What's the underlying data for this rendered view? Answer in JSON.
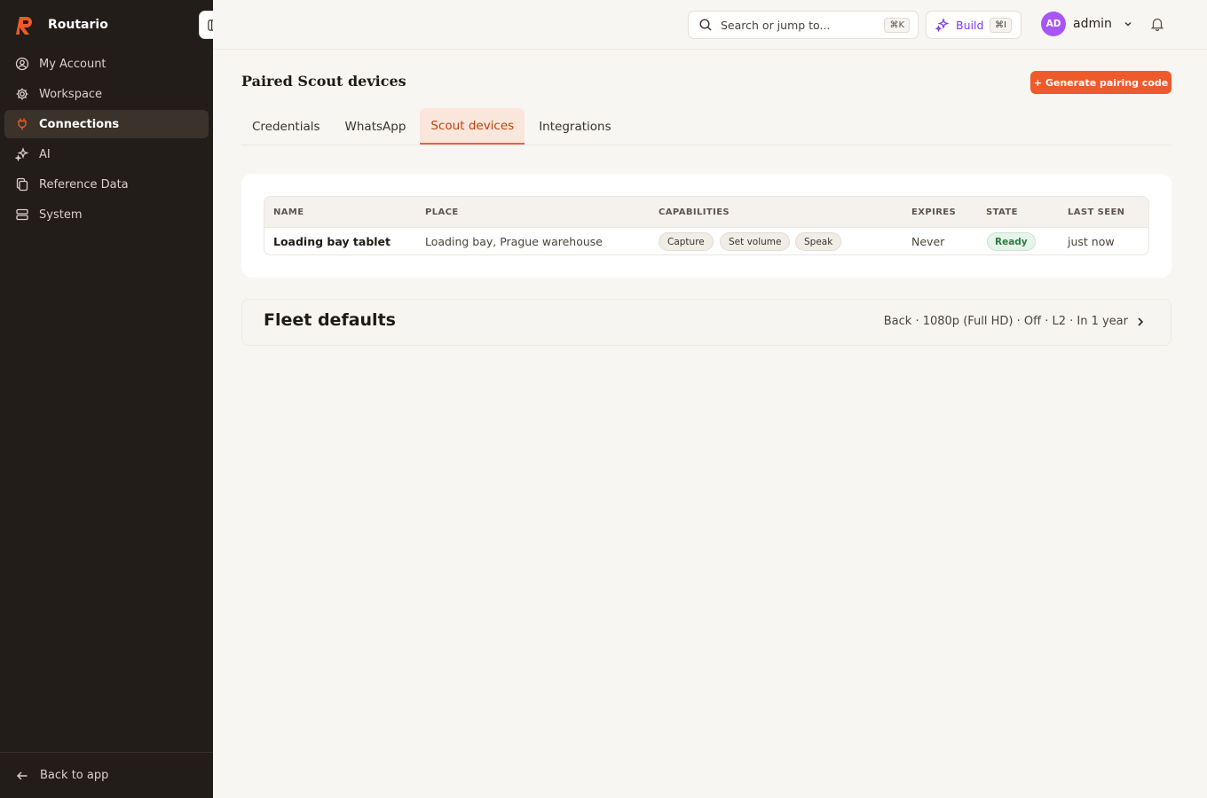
{
  "brand": {
    "name": "Routario",
    "accent": "#ee5a2a"
  },
  "sidebar": {
    "items": [
      {
        "label": "My Account",
        "icon": "user-circle-icon"
      },
      {
        "label": "Workspace",
        "icon": "gear-icon"
      },
      {
        "label": "Connections",
        "icon": "plug-icon",
        "active": true
      },
      {
        "label": "AI",
        "icon": "sparkles-icon"
      },
      {
        "label": "Reference Data",
        "icon": "copy-icon"
      },
      {
        "label": "System",
        "icon": "server-icon"
      }
    ],
    "back_label": "Back to app"
  },
  "topbar": {
    "search_placeholder": "Search or jump to...",
    "search_shortcut": "⌘K",
    "build_label": "Build",
    "build_shortcut": "⌘I",
    "user_initials": "AD",
    "user_name": "admin"
  },
  "page": {
    "title": "Paired Scout devices",
    "generate_button": "+ Generate pairing code",
    "tabs": [
      "Credentials",
      "WhatsApp",
      "Scout devices",
      "Integrations"
    ],
    "active_tab": "Scout devices"
  },
  "devices_table": {
    "columns": [
      "NAME",
      "PLACE",
      "CAPABILITIES",
      "EXPIRES",
      "STATE",
      "LAST SEEN"
    ],
    "rows": [
      {
        "name": "Loading bay tablet",
        "place": "Loading bay, Prague warehouse",
        "capabilities": [
          "Capture",
          "Set volume",
          "Speak"
        ],
        "expires": "Never",
        "state": "Ready",
        "last_seen": "just now"
      }
    ]
  },
  "fleet": {
    "title": "Fleet defaults",
    "summary": "Back · 1080p (Full HD) · Off · L2 · In 1 year"
  }
}
